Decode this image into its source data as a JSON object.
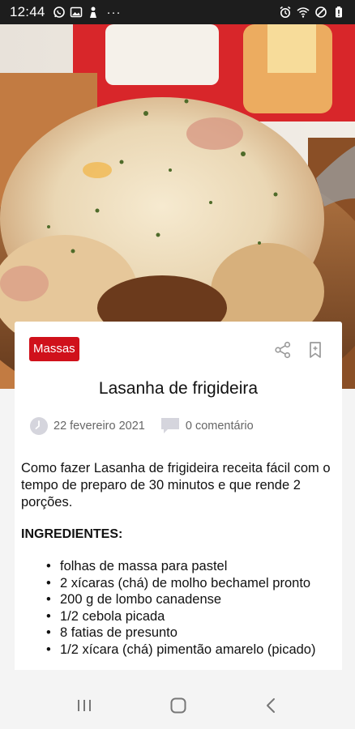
{
  "status_bar": {
    "time": "12:44",
    "left_icons": [
      "whatsapp-icon",
      "gallery-icon",
      "notification-icon"
    ],
    "overflow": "···",
    "right_icons": [
      "alarm-icon",
      "wifi-icon",
      "do-not-disturb-icon",
      "battery-icon"
    ]
  },
  "post": {
    "category": "Massas",
    "title": "Lasanha de frigideira",
    "date": "22 fevereiro 2021",
    "comments": "0 comentário",
    "intro": "Como fazer Lasanha de frigideira receita fácil com o tempo de preparo de 30 minutos e que rende 2 porções.",
    "ingredients_heading": "INGREDIENTES:",
    "ingredients": [
      "folhas de massa para pastel",
      "2 xícaras (chá) de molho bechamel pronto",
      "200 g de lombo canadense",
      "1/2 cebola picada",
      "8 fatias de presunto",
      "1/2 xícara (chá) pimentão amarelo (picado)"
    ]
  },
  "colors": {
    "badge": "#d0111b",
    "status_bar": "#1d1d1d",
    "meta_text": "#666666"
  },
  "nav_bar": [
    "recent-apps-icon",
    "home-icon",
    "back-icon"
  ]
}
